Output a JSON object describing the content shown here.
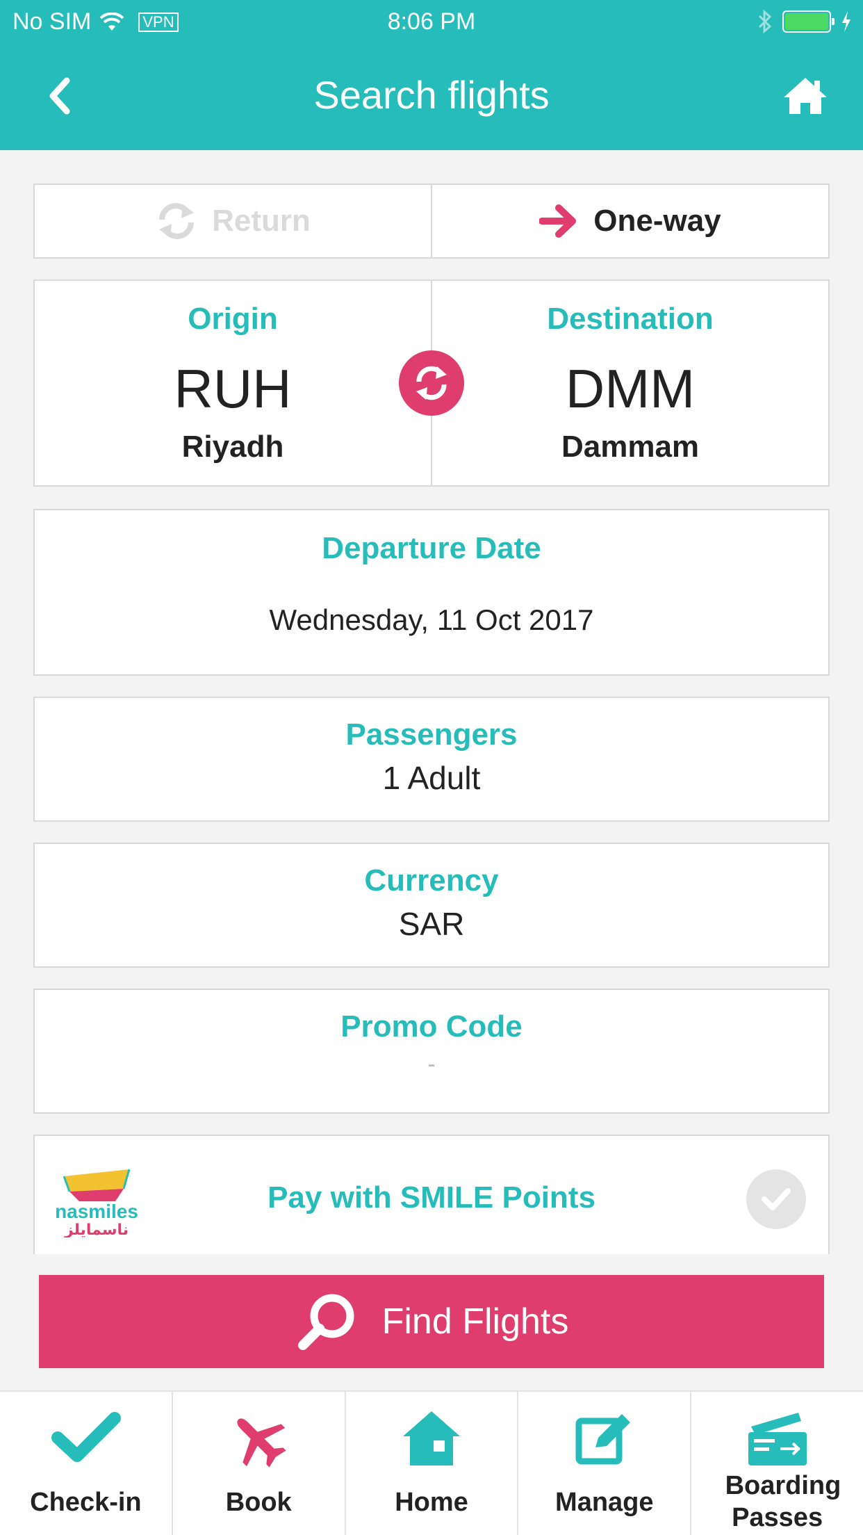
{
  "status_bar": {
    "carrier": "No SIM",
    "vpn": "VPN",
    "time": "8:06 PM"
  },
  "header": {
    "title": "Search flights"
  },
  "trip_type": {
    "return_label": "Return",
    "oneway_label": "One-way",
    "selected": "One-way"
  },
  "route": {
    "origin_label": "Origin",
    "origin_code": "RUH",
    "origin_city": "Riyadh",
    "destination_label": "Destination",
    "destination_code": "DMM",
    "destination_city": "Dammam"
  },
  "departure": {
    "label": "Departure Date",
    "value": "Wednesday, 11 Oct 2017"
  },
  "passengers": {
    "label": "Passengers",
    "value": "1 Adult"
  },
  "currency": {
    "label": "Currency",
    "value": "SAR"
  },
  "promo": {
    "label": "Promo Code",
    "value": "-"
  },
  "smile": {
    "logo_text": "nasmiles",
    "logo_text_ar": "ناسمايلز",
    "label": "Pay with SMILE Points",
    "checked": false
  },
  "find_button": {
    "label": "Find Flights"
  },
  "tabs": [
    {
      "label": "Check-in",
      "icon": "checkmark-icon"
    },
    {
      "label": "Book",
      "icon": "airplane-icon"
    },
    {
      "label": "Home",
      "icon": "home-icon"
    },
    {
      "label": "Manage",
      "icon": "edit-icon"
    },
    {
      "label": "Boarding Passes",
      "icon": "boarding-pass-icon"
    }
  ],
  "colors": {
    "primary": "#26bcb9",
    "accent": "#de3d6d"
  }
}
